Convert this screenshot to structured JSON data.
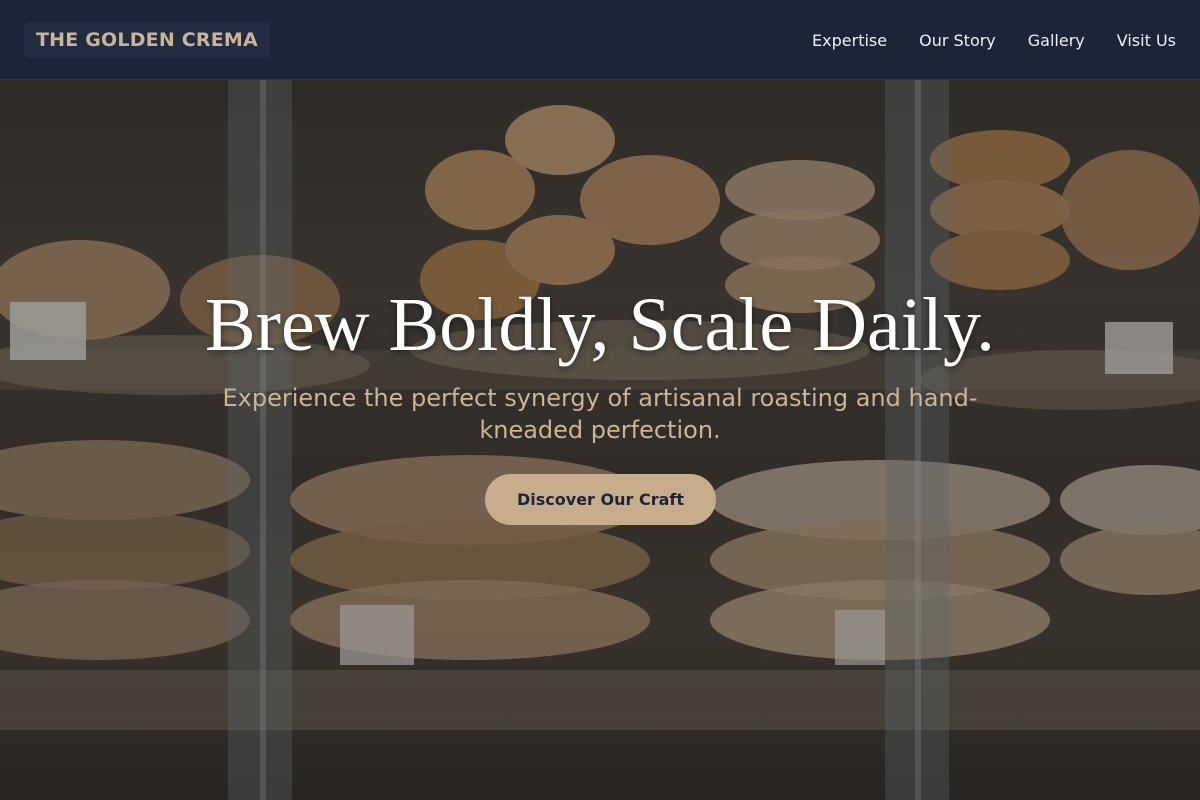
{
  "brand": {
    "name": "THE GOLDEN CREMA"
  },
  "nav": {
    "items": [
      {
        "label": "Expertise"
      },
      {
        "label": "Our Story"
      },
      {
        "label": "Gallery"
      },
      {
        "label": "Visit Us"
      }
    ]
  },
  "hero": {
    "headline": "Brew Boldly, Scale Daily.",
    "subheadline": "Experience the perfect synergy of artisanal roasting and hand-kneaded perfection.",
    "cta_label": "Discover Our Craft",
    "background_image": "bakery display case with croissants and pastries"
  },
  "colors": {
    "nav_bg": "#1c2538",
    "brand_text": "#c9b49a",
    "accent": "#c8ad8d",
    "subheadline": "#cdb495"
  }
}
